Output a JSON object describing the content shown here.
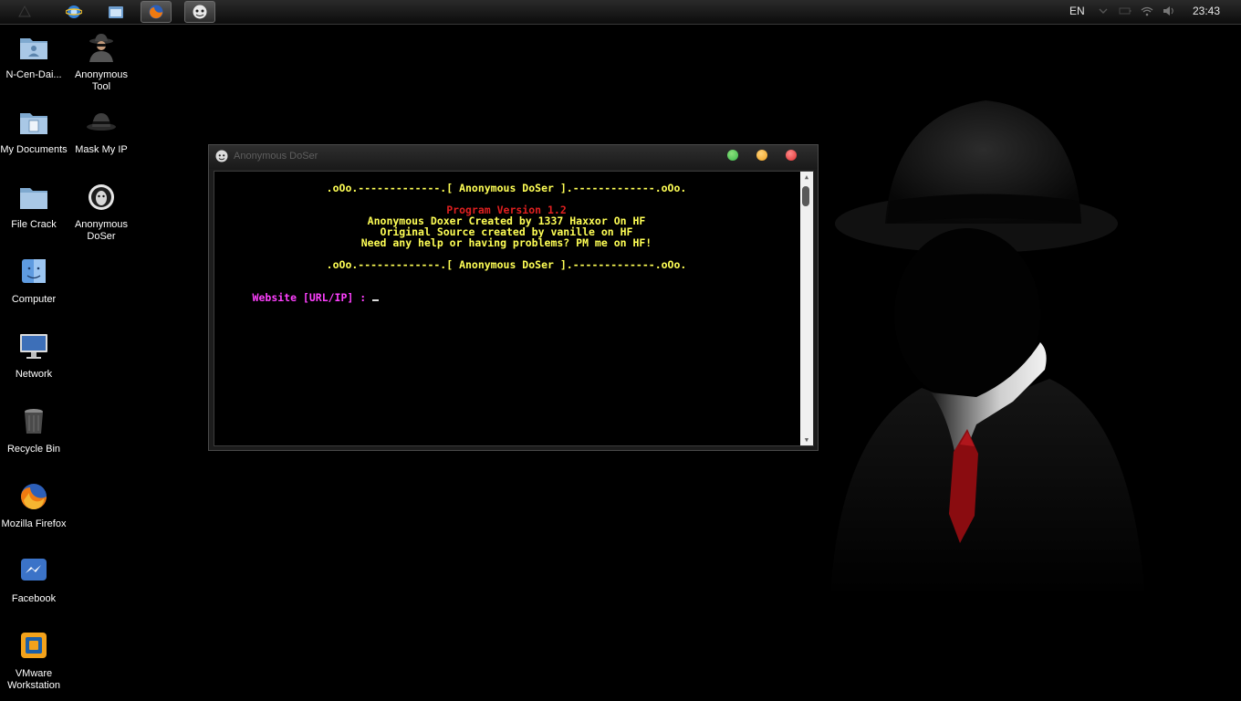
{
  "taskbar": {
    "language": "EN",
    "clock": "23:43",
    "buttons": [
      {
        "icon": "start-orb-icon"
      },
      {
        "icon": "ie-browser-icon"
      },
      {
        "icon": "file-explorer-icon"
      },
      {
        "icon": "firefox-icon"
      },
      {
        "icon": "anonymous-mask-icon",
        "active": true
      }
    ],
    "tray_icons": [
      "chevron-down-icon",
      "battery-icon",
      "wifi-icon",
      "volume-icon"
    ]
  },
  "desktop": {
    "icons": [
      {
        "label": "N-Cen-Dai...",
        "icon": "user-folder-icon"
      },
      {
        "label": "Anonymous Tool",
        "icon": "spy-man-icon"
      },
      {
        "label": "My Documents",
        "icon": "documents-folder-icon"
      },
      {
        "label": "Mask My IP",
        "icon": "fedora-hat-icon"
      },
      {
        "label": "File Crack",
        "icon": "folder-icon"
      },
      {
        "label": "Anonymous DoSer",
        "icon": "anonymous-mask-icon"
      },
      {
        "label": "Computer",
        "icon": "finder-icon"
      },
      {
        "label": "Network",
        "icon": "monitor-icon"
      },
      {
        "label": "Recycle Bin",
        "icon": "trash-icon"
      },
      {
        "label": "Mozilla Firefox",
        "icon": "firefox-icon"
      },
      {
        "label": "Facebook",
        "icon": "messenger-icon"
      },
      {
        "label": "VMware Workstation",
        "icon": "vmware-icon"
      }
    ]
  },
  "window": {
    "title": "Anonymous DoSer",
    "controls": [
      "maximize-button",
      "minimize-button",
      "close-button"
    ],
    "colors": {
      "green": "#3bb84a",
      "orange": "#f0a020",
      "red": "#e03030"
    },
    "console": {
      "banner": ".oOo.-------------.[ Anonymous DoSer ].-------------.oOo.",
      "version": "Program Version 1.2",
      "credit_line": "Anonymous Doxer Created by 1337 Haxxor On HF",
      "source_line": "Original Source created by vanille on HF",
      "help_line": "Need any help or having problems? PM me on HF!",
      "prompt": "Website [URL/IP] : "
    }
  }
}
